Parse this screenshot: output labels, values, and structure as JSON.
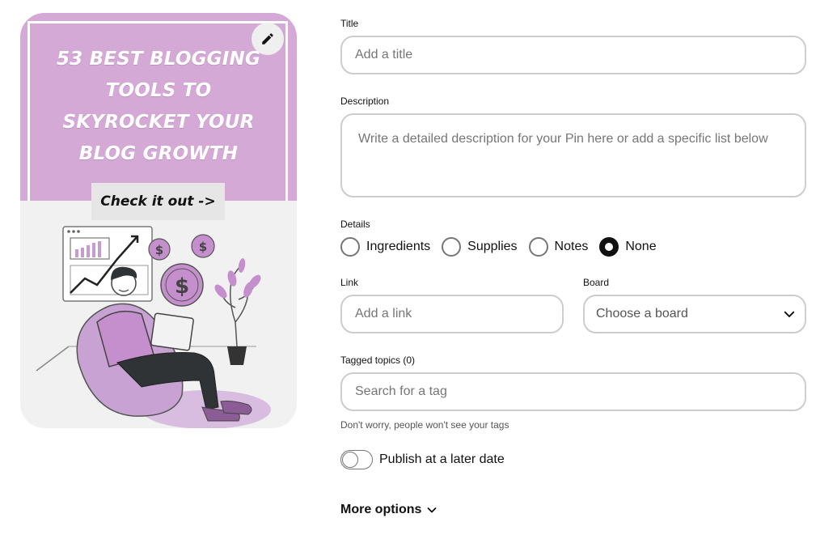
{
  "pin": {
    "headline_lines": [
      "53 BEST BLOGGING",
      "TOOLS TO",
      "SKYROCKET YOUR",
      "BLOG GROWTH"
    ],
    "cta": "Check it out ->",
    "edit_icon": "pencil-icon",
    "accent_color": "#d4a9d6"
  },
  "form": {
    "title": {
      "label": "Title",
      "placeholder": "Add a title",
      "value": ""
    },
    "description": {
      "label": "Description",
      "placeholder": "Write a detailed description for your Pin here or add a specific list below",
      "value": ""
    },
    "details": {
      "label": "Details",
      "options": [
        "Ingredients",
        "Supplies",
        "Notes",
        "None"
      ],
      "selected": "None"
    },
    "link": {
      "label": "Link",
      "placeholder": "Add a link",
      "value": ""
    },
    "board": {
      "label": "Board",
      "value": "Choose a board",
      "icon": "chevron-down-icon"
    },
    "tagged_topics": {
      "label": "Tagged topics (0)",
      "placeholder": "Search for a tag",
      "helper": "Don't worry, people won't see your tags"
    },
    "publish_later": {
      "label": "Publish at a later date",
      "enabled": false
    },
    "more_options": {
      "label": "More options",
      "icon": "chevron-down-icon"
    }
  }
}
